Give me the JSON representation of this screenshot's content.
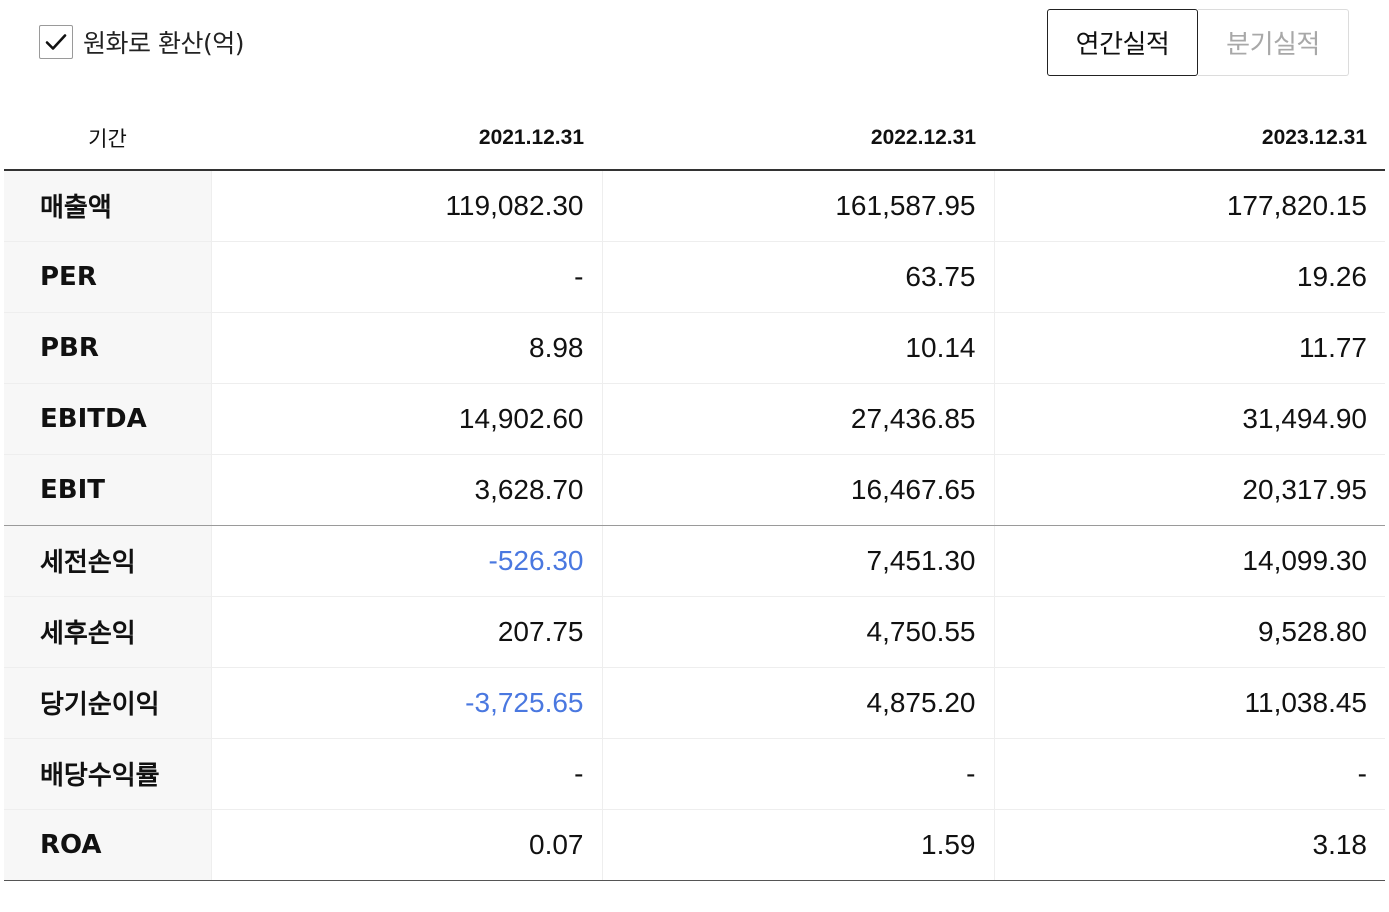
{
  "convert": {
    "label": "원화로 환산(억)",
    "checked": true
  },
  "tabs": {
    "annual": "연간실적",
    "quarterly": "분기실적",
    "active": "annual"
  },
  "table": {
    "header": {
      "label": "기간",
      "years": [
        "2021.12.31",
        "2022.12.31",
        "2023.12.31"
      ]
    },
    "rows": [
      {
        "label": "매출액",
        "values": [
          "119,082.30",
          "161,587.95",
          "177,820.15"
        ]
      },
      {
        "label": "PER",
        "values": [
          "-",
          "63.75",
          "19.26"
        ]
      },
      {
        "label": "PBR",
        "values": [
          "8.98",
          "10.14",
          "11.77"
        ]
      },
      {
        "label": "EBITDA",
        "values": [
          "14,902.60",
          "27,436.85",
          "31,494.90"
        ]
      },
      {
        "label": "EBIT",
        "values": [
          "3,628.70",
          "16,467.65",
          "20,317.95"
        ]
      },
      {
        "label": "세전손익",
        "values": [
          "-526.30",
          "7,451.30",
          "14,099.30"
        ]
      },
      {
        "label": "세후손익",
        "values": [
          "207.75",
          "4,750.55",
          "9,528.80"
        ]
      },
      {
        "label": "당기순이익",
        "values": [
          "-3,725.65",
          "4,875.20",
          "11,038.45"
        ]
      },
      {
        "label": "배당수익률",
        "values": [
          "-",
          "-",
          "-"
        ]
      },
      {
        "label": "ROA",
        "values": [
          "0.07",
          "1.59",
          "3.18"
        ]
      }
    ]
  },
  "colors": {
    "negative": "#4a78e0",
    "header_rule": "#333333",
    "label_bg": "#f7f7f7"
  }
}
